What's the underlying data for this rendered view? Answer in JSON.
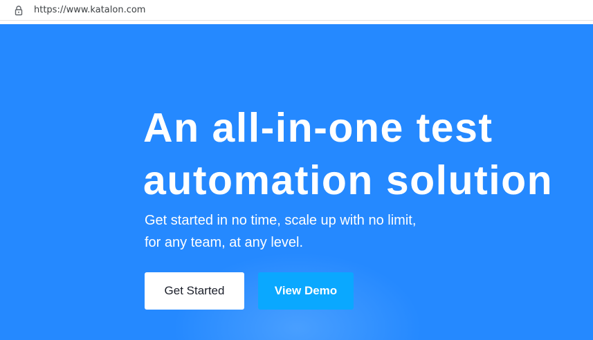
{
  "browser": {
    "url": "https://www.katalon.com"
  },
  "hero": {
    "title_line1": "An all-in-one test",
    "title_line2": "automation solution",
    "subtitle_line1": "Get started in no time, scale up with no limit,",
    "subtitle_line2": "for any team, at any level.",
    "primary_button": "Get Started",
    "secondary_button": "View Demo"
  },
  "colors": {
    "hero_background": "#2589ff",
    "primary_button_bg": "#ffffff",
    "secondary_button_bg": "#0aa8ff",
    "text_on_hero": "#ffffff"
  },
  "icons": {
    "address_bar": "lock-icon"
  }
}
